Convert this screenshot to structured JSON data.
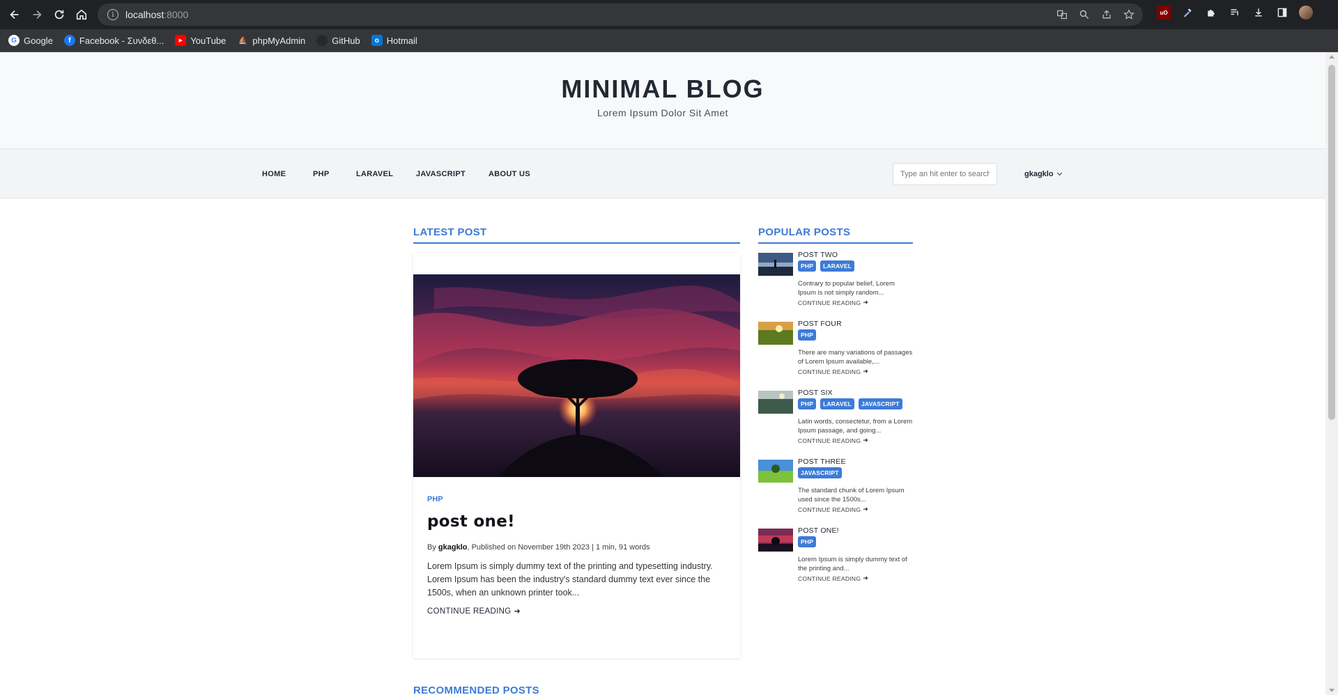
{
  "browser": {
    "url_host": "localhost",
    "url_port": ":8000",
    "bookmarks": [
      {
        "label": "Google",
        "icon": "google-icon"
      },
      {
        "label": "Facebook - Συνδεθ...",
        "icon": "facebook-icon"
      },
      {
        "label": "YouTube",
        "icon": "youtube-icon"
      },
      {
        "label": "phpMyAdmin",
        "icon": "phpmyadmin-icon"
      },
      {
        "label": "GitHub",
        "icon": "github-icon"
      },
      {
        "label": "Hotmail",
        "icon": "outlook-icon"
      }
    ]
  },
  "site": {
    "title": "MINIMAL BLOG",
    "subtitle": "Lorem Ipsum Dolor Sit Amet"
  },
  "nav": {
    "items": [
      "HOME",
      "PHP",
      "LARAVEL",
      "JAVASCRIPT",
      "ABOUT US"
    ],
    "search_placeholder": "Type an hit enter to search",
    "user": "gkagklo"
  },
  "latest": {
    "heading": "LATEST POST",
    "category": "PHP",
    "title": "post one!",
    "meta_by": "By ",
    "meta_author": "gkagklo",
    "meta_rest": ", Published on November 19th 2023 | 1 min, 91 words",
    "excerpt": "Lorem Ipsum is simply dummy text of the printing and typesetting industry. Lorem Ipsum has been the industry's standard dummy text ever since the 1500s, when an unknown printer took...",
    "read_more": "CONTINUE READING"
  },
  "popular": {
    "heading": "POPULAR POSTS",
    "posts": [
      {
        "title": "POST TWO",
        "tags": [
          "PHP",
          "LARAVEL"
        ],
        "excerpt": "Contrary to popular belief, Lorem Ipsum is not simply random...",
        "read_more": "CONTINUE READING"
      },
      {
        "title": "POST FOUR",
        "tags": [
          "PHP"
        ],
        "excerpt": "There are many variations of passages of Lorem Ipsum available,...",
        "read_more": "CONTINUE READING"
      },
      {
        "title": "POST SIX",
        "tags": [
          "PHP",
          "LARAVEL",
          "JAVASCRIPT"
        ],
        "excerpt": "Latin words, consectetur, from a Lorem Ipsum passage, and going...",
        "read_more": "CONTINUE READING"
      },
      {
        "title": "POST THREE",
        "tags": [
          "JAVASCRIPT"
        ],
        "excerpt": "The standard chunk of Lorem Ipsum used since the 1500s...",
        "read_more": "CONTINUE READING"
      },
      {
        "title": "POST ONE!",
        "tags": [
          "PHP"
        ],
        "excerpt": "Lorem Ipsum is simply dummy text of the printing and...",
        "read_more": "CONTINUE READING"
      }
    ]
  },
  "recommended": {
    "heading": "RECOMMENDED POSTS"
  },
  "colors": {
    "accent": "#3d7bd8",
    "title": "#212933"
  }
}
